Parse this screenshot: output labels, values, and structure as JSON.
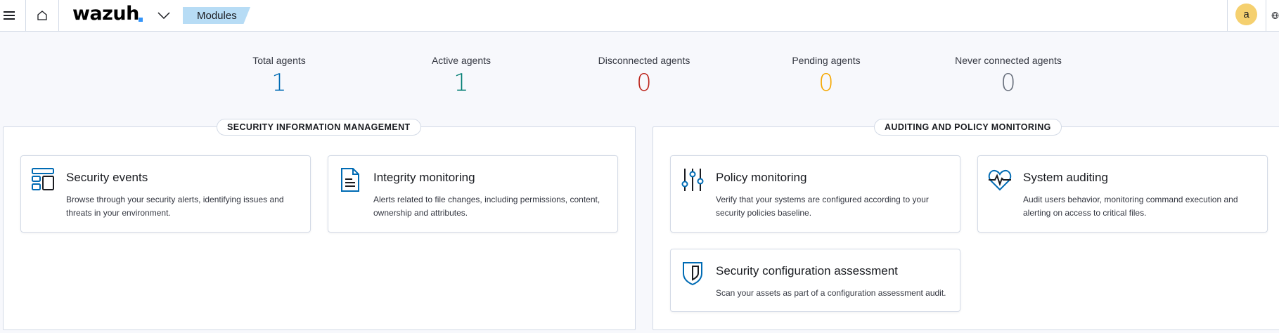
{
  "header": {
    "menu_icon": "hamburger-icon",
    "home_icon": "home-icon",
    "logo_text": "wazuh",
    "dropdown_icon": "chevron-down-icon",
    "breadcrumb": "Modules",
    "avatar_letter": "a",
    "help_icon": "globe-icon"
  },
  "stats": [
    {
      "label": "Total agents",
      "value": "1",
      "color": "#006bb4"
    },
    {
      "label": "Active agents",
      "value": "1",
      "color": "#017d73"
    },
    {
      "label": "Disconnected agents",
      "value": "0",
      "color": "#bd271e"
    },
    {
      "label": "Pending agents",
      "value": "0",
      "color": "#f5a700"
    },
    {
      "label": "Never connected agents",
      "value": "0",
      "color": "#69707d"
    }
  ],
  "sections": [
    {
      "title": "SECURITY INFORMATION MANAGEMENT",
      "cards": [
        {
          "title": "Security events",
          "description": "Browse through your security alerts, identifying issues and threats in your environment.",
          "icon": "dashboard-icon"
        },
        {
          "title": "Integrity monitoring",
          "description": "Alerts related to file changes, including permissions, content, ownership and attributes.",
          "icon": "document-icon"
        }
      ]
    },
    {
      "title": "AUDITING AND POLICY MONITORING",
      "cards": [
        {
          "title": "Policy monitoring",
          "description": "Verify that your systems are configured according to your security policies baseline.",
          "icon": "sliders-icon"
        },
        {
          "title": "System auditing",
          "description": "Audit users behavior, monitoring command execution and alerting on access to critical files.",
          "icon": "heartbeat-icon"
        },
        {
          "title": "Security configuration assessment",
          "description": "Scan your assets as part of a configuration assessment audit.",
          "icon": "shield-icon"
        }
      ]
    }
  ],
  "colors": {
    "accent": "#006bb4",
    "breadcrumb_bg": "#b7dcf5",
    "avatar_bg": "#f5d06f"
  }
}
